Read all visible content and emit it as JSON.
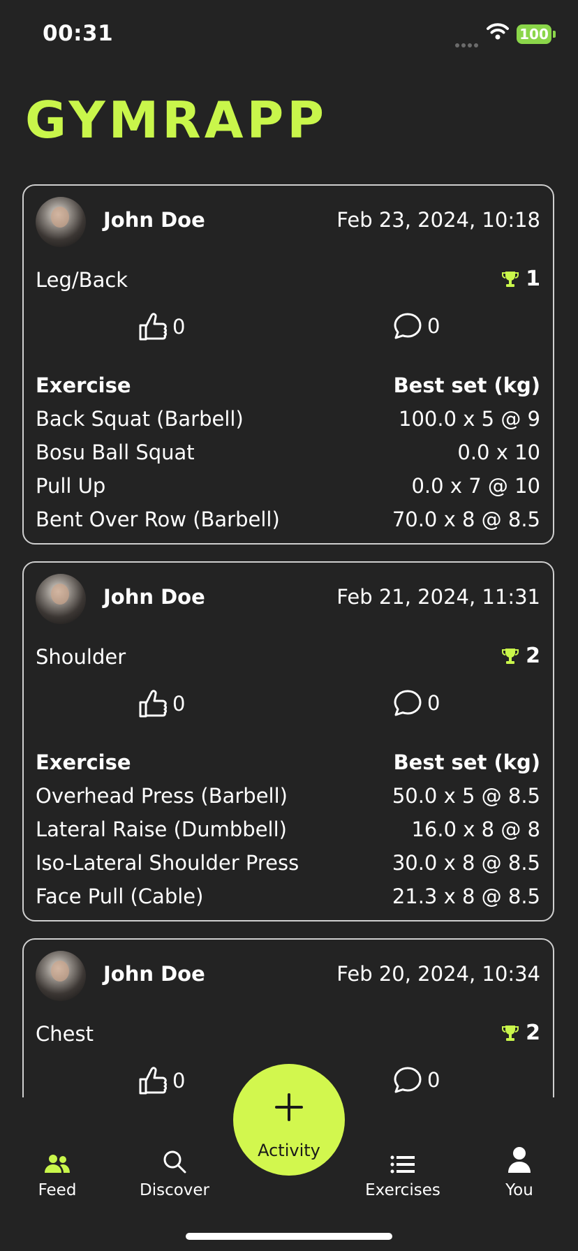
{
  "status_bar": {
    "time": "00:31",
    "battery": "100"
  },
  "app": {
    "title": "GYMRAPP"
  },
  "colors": {
    "accent": "#c9f64b",
    "background": "#232323",
    "battery": "#8bd64a"
  },
  "feed": {
    "table_headers": {
      "exercise": "Exercise",
      "best_set": "Best set (kg)"
    },
    "posts": [
      {
        "user": "John Doe",
        "date": "Feb 23, 2024, 10:18",
        "workout": "Leg/Back",
        "pr_count": "1",
        "likes": "0",
        "comments": "0",
        "exercises": [
          {
            "name": "Back Squat (Barbell)",
            "best": "100.0 x 5 @ 9"
          },
          {
            "name": "Bosu Ball Squat",
            "best": "0.0 x 10"
          },
          {
            "name": "Pull Up",
            "best": "0.0 x 7 @ 10"
          },
          {
            "name": "Bent Over Row (Barbell)",
            "best": "70.0 x 8 @ 8.5"
          }
        ]
      },
      {
        "user": "John Doe",
        "date": "Feb 21, 2024, 11:31",
        "workout": "Shoulder",
        "pr_count": "2",
        "likes": "0",
        "comments": "0",
        "exercises": [
          {
            "name": "Overhead Press (Barbell)",
            "best": "50.0 x 5 @ 8.5"
          },
          {
            "name": "Lateral Raise (Dumbbell)",
            "best": "16.0 x 8 @ 8"
          },
          {
            "name": "Iso-Lateral Shoulder Press",
            "best": "30.0 x 8 @ 8.5"
          },
          {
            "name": "Face Pull (Cable)",
            "best": "21.3 x 8 @ 8.5"
          }
        ]
      },
      {
        "user": "John Doe",
        "date": "Feb 20, 2024, 10:34",
        "workout": "Chest",
        "pr_count": "2",
        "likes": "0",
        "comments": "0"
      }
    ]
  },
  "nav": {
    "feed": {
      "label": "Feed",
      "icon": "users-icon"
    },
    "discover": {
      "label": "Discover",
      "icon": "search-icon"
    },
    "activity": {
      "label": "Activity",
      "icon": "plus-icon"
    },
    "exercises": {
      "label": "Exercises",
      "icon": "list-icon"
    },
    "you": {
      "label": "You",
      "icon": "user-icon"
    }
  }
}
